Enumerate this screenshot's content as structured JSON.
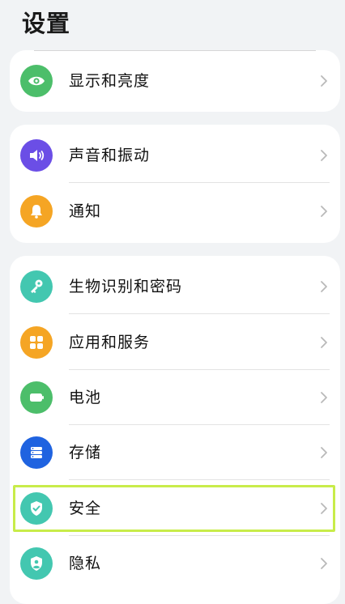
{
  "header": {
    "title": "设置"
  },
  "groups": [
    {
      "items": [
        {
          "label": "显示和亮度",
          "icon": "eye-icon",
          "color": "#4cbe6a"
        }
      ]
    },
    {
      "items": [
        {
          "label": "声音和振动",
          "icon": "speaker-icon",
          "color": "#6b4ee6"
        },
        {
          "label": "通知",
          "icon": "bell-icon",
          "color": "#f5a524"
        }
      ]
    },
    {
      "items": [
        {
          "label": "生物识别和密码",
          "icon": "key-icon",
          "color": "#43c7b0"
        },
        {
          "label": "应用和服务",
          "icon": "apps-grid-icon",
          "color": "#f5a524"
        },
        {
          "label": "电池",
          "icon": "battery-icon",
          "color": "#4cbe6a"
        },
        {
          "label": "存储",
          "icon": "storage-icon",
          "color": "#1f63e0"
        },
        {
          "label": "安全",
          "icon": "shield-check-icon",
          "color": "#43c7b0",
          "highlighted": true
        },
        {
          "label": "隐私",
          "icon": "privacy-shield-icon",
          "color": "#43c7b0"
        }
      ]
    }
  ],
  "highlight_color": "#c8ec4a"
}
